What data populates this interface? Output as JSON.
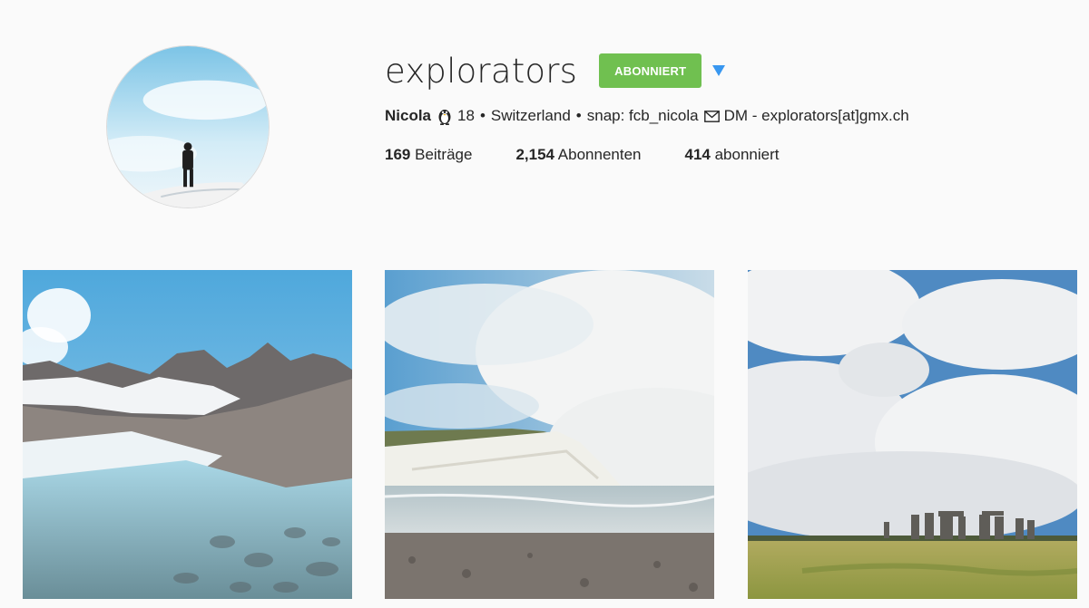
{
  "profile": {
    "username": "explorators",
    "follow_button": "ABONNIERT",
    "bio": {
      "name": "Nicola",
      "age": "18",
      "sep1": "•",
      "location": "Switzerland",
      "sep2": "•",
      "snap": "snap: fcb_nicola",
      "contact": "DM - explorators[at]gmx.ch"
    },
    "stats": [
      {
        "count": "169",
        "label": "Beiträge"
      },
      {
        "count": "2,154",
        "label": "Abonnenten"
      },
      {
        "count": "414",
        "label": "abonniert"
      }
    ]
  },
  "icons": {
    "bio_icon": "penguin-icon",
    "contact_icon": "mail-icon",
    "dropdown": "caret-down-icon"
  },
  "colors": {
    "follow_green": "#70c050",
    "caret_blue": "#3897f0",
    "background": "#fafafa"
  },
  "posts": [
    {
      "subject": "alpine lake"
    },
    {
      "subject": "white cliffs"
    },
    {
      "subject": "stone circle"
    }
  ]
}
